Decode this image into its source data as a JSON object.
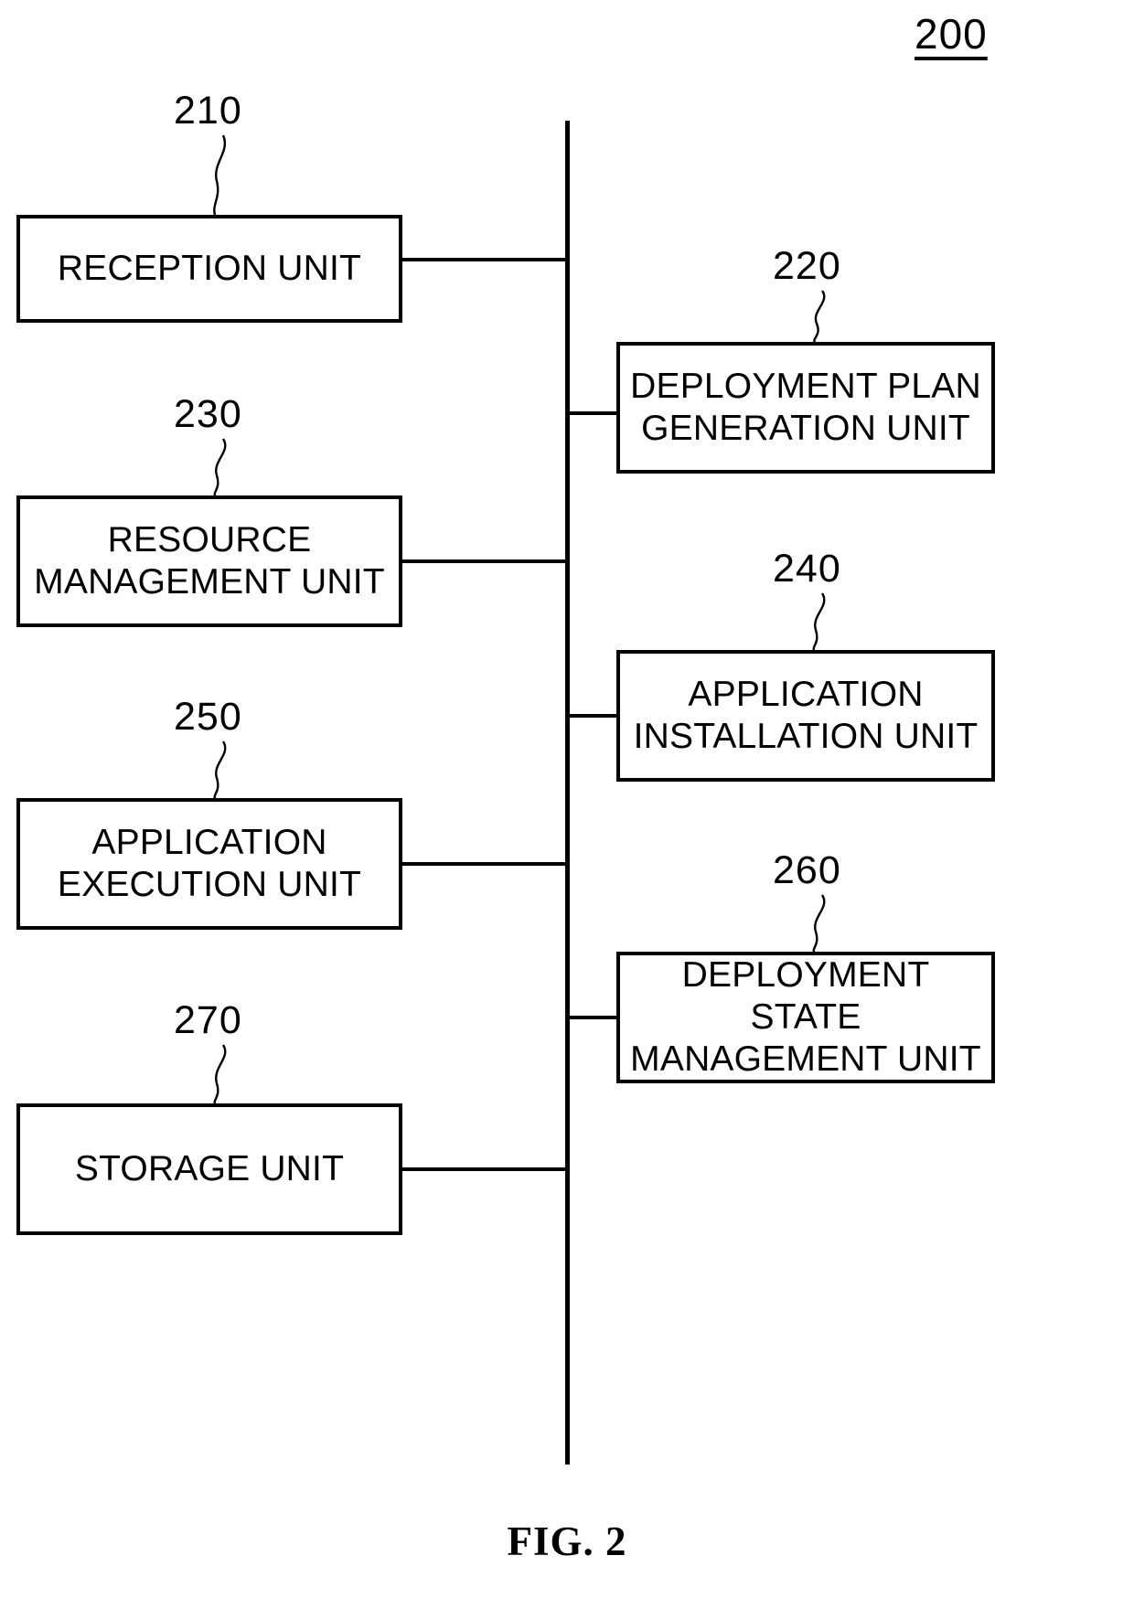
{
  "figure": {
    "caption": "FIG. 2",
    "system_ref": "200"
  },
  "bus": {
    "label": "system-bus"
  },
  "units": [
    {
      "ref": "210",
      "label": "RECEPTION UNIT",
      "side": "left"
    },
    {
      "ref": "220",
      "label": "DEPLOYMENT PLAN\nGENERATION UNIT",
      "side": "right"
    },
    {
      "ref": "230",
      "label": "RESOURCE\nMANAGEMENT UNIT",
      "side": "left"
    },
    {
      "ref": "240",
      "label": "APPLICATION\nINSTALLATION UNIT",
      "side": "right"
    },
    {
      "ref": "250",
      "label": "APPLICATION\nEXECUTION UNIT",
      "side": "left"
    },
    {
      "ref": "260",
      "label": "DEPLOYMENT STATE\nMANAGEMENT UNIT",
      "side": "right"
    },
    {
      "ref": "270",
      "label": "STORAGE UNIT",
      "side": "left"
    }
  ],
  "colors": {
    "stroke": "#000000",
    "background": "#ffffff"
  }
}
